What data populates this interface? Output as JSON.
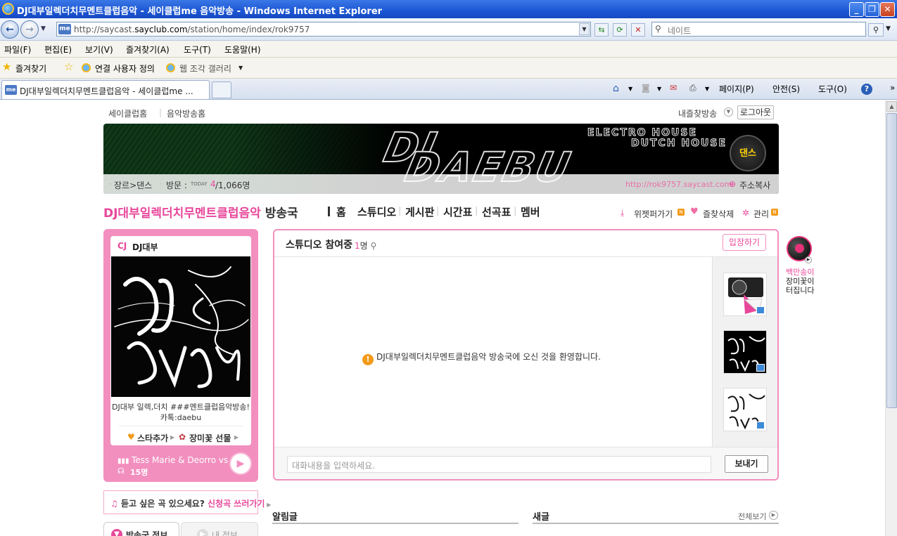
{
  "window": {
    "title": "DJ대부일렉더치무멘트클럽음악 - 세이클럽me 음악방송 - Windows Internet Explorer",
    "controls": [
      "_",
      "❐",
      "✕"
    ]
  },
  "address": {
    "url_prefix": "http://saycast.",
    "url_domain": "sayclub.com",
    "url_path": "/station/home/index/rok9757",
    "search_placeholder": "네이트",
    "favicon": "me"
  },
  "menu": [
    "파일(F)",
    "편집(E)",
    "보기(V)",
    "즐겨찾기(A)",
    "도구(T)",
    "도움말(H)"
  ],
  "favorites": {
    "label": "즐겨찾기",
    "items": [
      "연결 사용자 정의",
      "웹 조각 갤러리"
    ]
  },
  "tab": {
    "title": "DJ대부일렉더치무멘트클럽음악 - 세이클럽me ...",
    "tools": [
      "페이지(P)",
      "안전(S)",
      "도구(O)"
    ]
  },
  "top_links": {
    "home": "세이클럽홈",
    "music": "음악방송홈",
    "my_station": "내즐찾방송",
    "logout": "로그아웃"
  },
  "banner": {
    "big1": "DJ",
    "big2": "DAEBU",
    "sub1": "ELECTRO HOUSE",
    "sub2": "DUTCH HOUSE",
    "genre_badge": "댄스",
    "genre": "장르>댄스",
    "visit_label": "방문 :",
    "today_label": "TODAY",
    "today_count": "4",
    "total_count": "/1,066명",
    "station_url": "http://rok9757.saycast.com",
    "copy_label": "주소복사"
  },
  "station": {
    "name": "DJ대부일렉더치무멘트클럽음악",
    "suffix": "방송국",
    "nav": [
      "홈",
      "스튜디오",
      "게시판",
      "시간표",
      "선곡표",
      "멤버"
    ],
    "widget": "위젯퍼가기",
    "fav_remove": "즐찾삭제",
    "manage": "관리"
  },
  "cj": {
    "label": "CJ",
    "name": "DJ대부",
    "desc_line1": "DJ대부 일렉,더치 ###멘트클럽음악방송!",
    "desc_line2": "카톡:daebu",
    "star_add": "스타추가",
    "rose_gift": "장미꽃 선물",
    "now_playing": "Tess Marie & Deorro vs",
    "listeners": "15명"
  },
  "request": {
    "question": "듣고 싶은 곡 있으세요?",
    "link": "신청곡 쓰러가기"
  },
  "subtabs": [
    "방송국 정보",
    "내 정보"
  ],
  "studio": {
    "title": "스튜디오 참여중",
    "count": "1",
    "count_unit": "명",
    "enter": "입장하기",
    "welcome": "DJ대부일렉더치무멘트클럽음악 방송국에 오신 것을 환영합니다.",
    "input_placeholder": "대화내용을 입력하세요.",
    "send": "보내기"
  },
  "promo": [
    "백만송이",
    "장미꽃이",
    "터집니다"
  ],
  "sections": {
    "notice": "알림글",
    "new": "새글",
    "more": "전체보기"
  },
  "colors": {
    "accent": "#e8479a",
    "pink_border": "#f28fbf"
  }
}
